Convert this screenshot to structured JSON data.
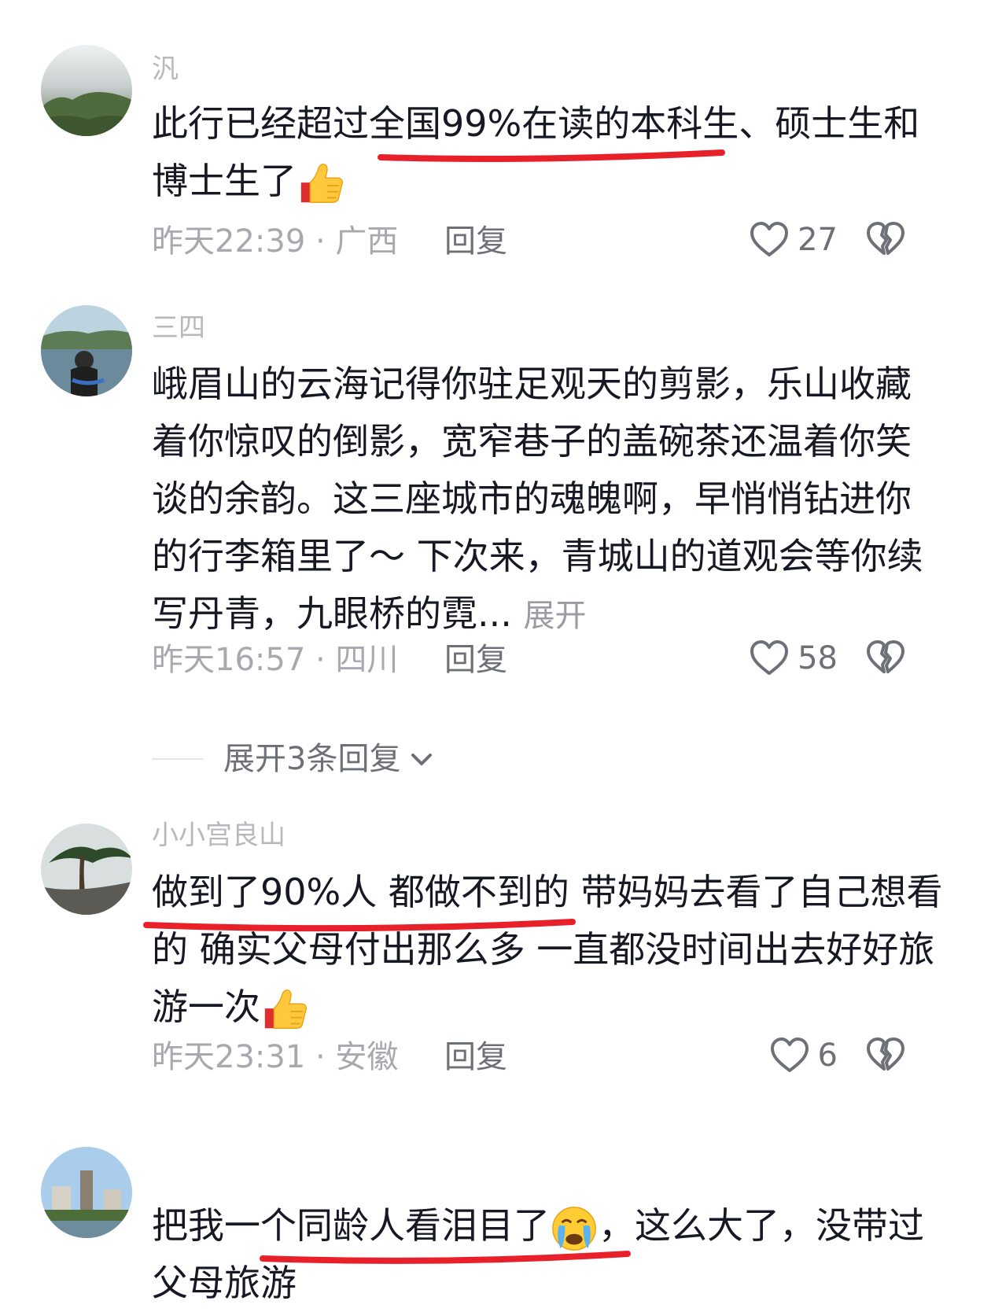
{
  "comments": [
    {
      "username": "汎",
      "text": "此行已经超过全国99%在读的本科生、硕士生和博士生了",
      "emoji": "thumbs-up",
      "time_location": "昨天22:39 · 广西",
      "reply_label": "回复",
      "likes": "27"
    },
    {
      "username": "三四",
      "text": "峨眉山的云海记得你驻足观天的剪影，乐山收藏着你惊叹的倒影，宽窄巷子的盖碗茶还温着你笑谈的余韵。这三座城市的魂魄啊，早悄悄钻进你的行李箱里了～ 下次来，青城山的道观会等你续写丹青，九眼桥的霓...",
      "expand_label": "展开",
      "time_location": "昨天16:57 · 四川",
      "reply_label": "回复",
      "likes": "58",
      "more_replies_label": "展开3条回复"
    },
    {
      "username": "小小宫良山",
      "text": "做到了90%人 都做不到的 带妈妈去看了自己想看的 确实父母付出那么多 一直都没时间出去好好旅游一次",
      "emoji": "thumbs-up",
      "time_location": "昨天23:31 · 安徽",
      "reply_label": "回复",
      "likes": "6"
    },
    {
      "username": "",
      "text": "把我一个同龄人看泪目了",
      "emoji": "loudly-crying-face",
      "text_after_emoji": "，这么大了，没带过父母旅游",
      "time_location": "",
      "reply_label": "",
      "likes": ""
    }
  ],
  "colors": {
    "annotation_red": "#e8202a",
    "meta_gray": "#a7a9ae",
    "text_dark": "#161823"
  },
  "icons": [
    "heart-outline-icon",
    "broken-heart-icon",
    "chevron-down-icon"
  ]
}
